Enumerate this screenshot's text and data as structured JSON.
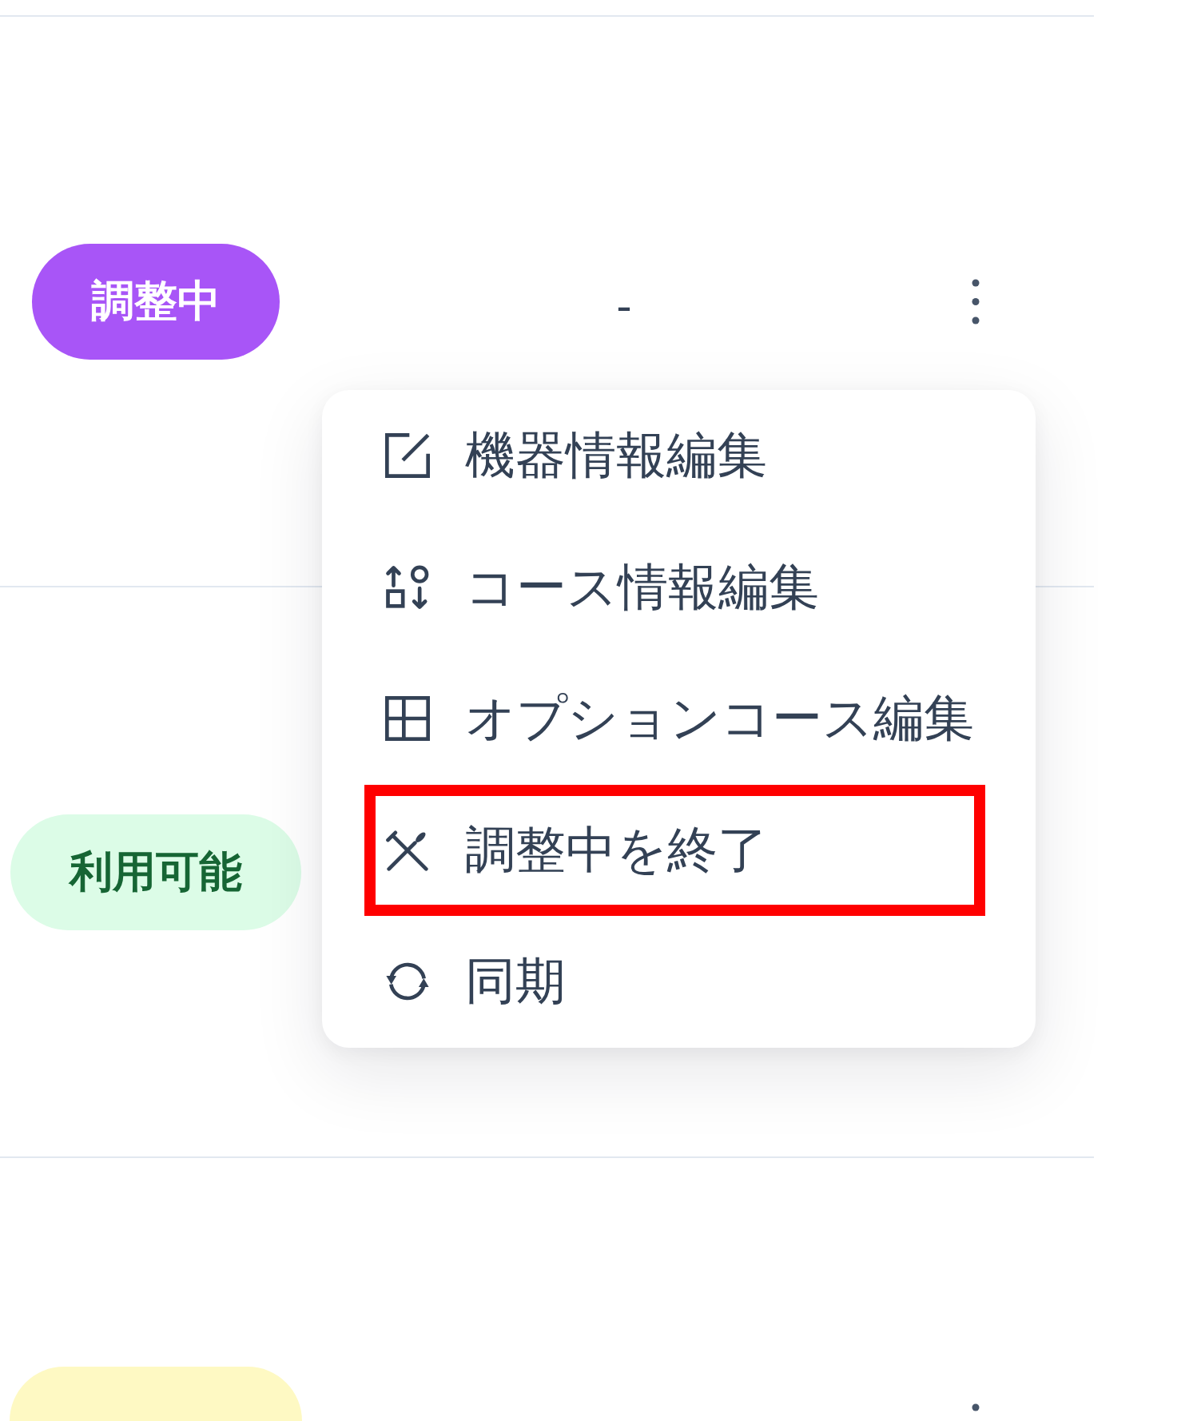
{
  "table": {
    "rows": [
      {
        "status": {
          "label": "調整中",
          "kind": "adjusting"
        },
        "value": "-",
        "cut_off": false
      },
      {
        "status": {
          "label": "利用可能",
          "kind": "available"
        },
        "cut_off": false
      },
      {
        "status": {
          "kind": "ended"
        },
        "cut_off": true
      }
    ]
  },
  "context_menu": {
    "open": true,
    "items": [
      {
        "label": "機器情報編集",
        "highlighted": false
      },
      {
        "label": "コース情報編集",
        "highlighted": false
      },
      {
        "label": "オプションコース編集",
        "highlighted": false
      },
      {
        "label": "調整中を終了",
        "highlighted": true
      },
      {
        "label": "同期",
        "highlighted": false
      }
    ]
  }
}
